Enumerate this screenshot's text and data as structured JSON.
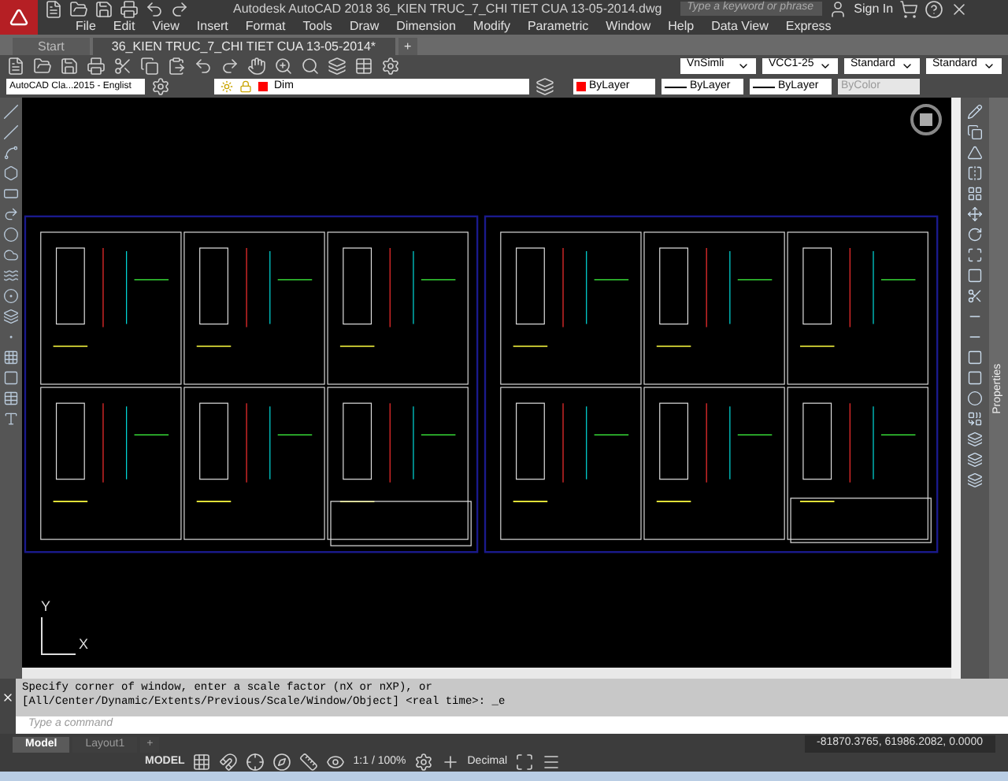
{
  "window": {
    "app": "Autodesk AutoCAD 2018",
    "file": "36_KIEN TRUC_7_CHI TIET CUA 13-05-2014.dwg",
    "search_placeholder": "Type a keyword or phrase",
    "sign_in": "Sign In"
  },
  "menu": [
    "File",
    "Edit",
    "View",
    "Insert",
    "Format",
    "Tools",
    "Draw",
    "Dimension",
    "Modify",
    "Parametric",
    "Window",
    "Help",
    "Data View",
    "Express"
  ],
  "file_tabs": [
    {
      "label": "Start",
      "selected": false
    },
    {
      "label": "36_KIEN TRUC_7_CHI TIET CUA 13-05-2014*",
      "selected": true
    }
  ],
  "new_tab": "+",
  "styles": [
    "VnSimli",
    "VCC1-25",
    "Standard",
    "Standard"
  ],
  "workspace": "AutoCAD Cla...2015 - Englist",
  "layer": {
    "name": "Dim",
    "color": "#ff0000"
  },
  "properties": [
    {
      "label": "ByLayer",
      "kind": "color",
      "color": "#ff0000",
      "disabled": false
    },
    {
      "label": "ByLayer",
      "kind": "linetype",
      "disabled": false
    },
    {
      "label": "ByLayer",
      "kind": "lineweight",
      "disabled": false
    },
    {
      "label": "ByColor",
      "kind": "plot",
      "disabled": true
    }
  ],
  "ucs": {
    "x": "X",
    "y": "Y"
  },
  "palette": "Properties",
  "command": {
    "history": [
      "Specify corner of window, enter a scale factor (nX or nXP), or",
      "[All/Center/Dynamic/Extents/Previous/Scale/Window/Object] <real time>: _e"
    ],
    "placeholder": "Type a command"
  },
  "layout_tabs": [
    {
      "label": "Model",
      "selected": true
    },
    {
      "label": "Layout1",
      "selected": false
    }
  ],
  "new_layout": "+",
  "coordinates": "-81870.3765, 61986.2082, 0.0000",
  "status": {
    "space": "MODEL",
    "scale": "1:1 / 100%",
    "units": "Decimal"
  }
}
